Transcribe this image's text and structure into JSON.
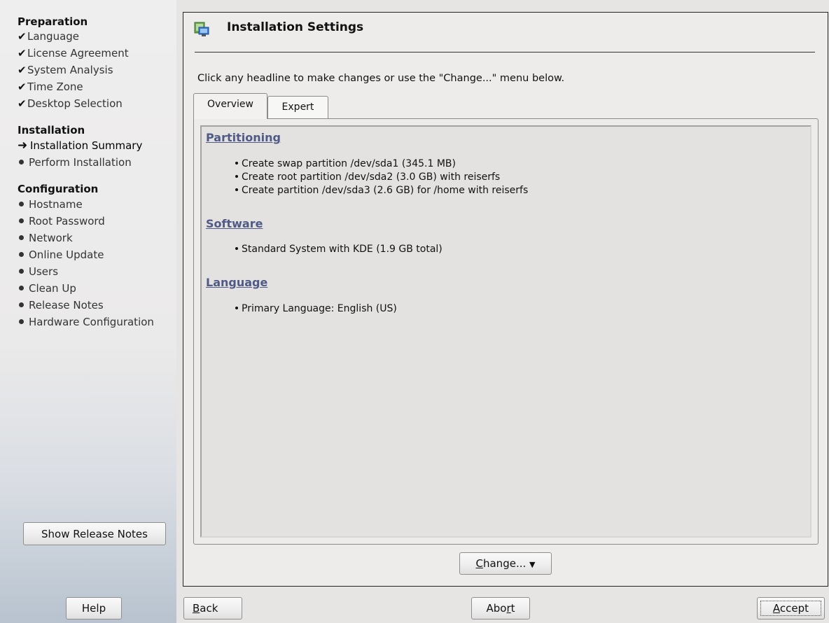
{
  "sidebar": {
    "sections": [
      {
        "title": "Preparation",
        "items": [
          {
            "label": "Language",
            "status": "done"
          },
          {
            "label": "License Agreement",
            "status": "done"
          },
          {
            "label": "System Analysis",
            "status": "done"
          },
          {
            "label": "Time Zone",
            "status": "done"
          },
          {
            "label": "Desktop Selection",
            "status": "done"
          }
        ]
      },
      {
        "title": "Installation",
        "items": [
          {
            "label": "Installation Summary",
            "status": "current"
          },
          {
            "label": "Perform Installation",
            "status": "pending"
          }
        ]
      },
      {
        "title": "Configuration",
        "items": [
          {
            "label": "Hostname",
            "status": "pending"
          },
          {
            "label": "Root Password",
            "status": "pending"
          },
          {
            "label": "Network",
            "status": "pending"
          },
          {
            "label": "Online Update",
            "status": "pending"
          },
          {
            "label": "Users",
            "status": "pending"
          },
          {
            "label": "Clean Up",
            "status": "pending"
          },
          {
            "label": "Release Notes",
            "status": "pending"
          },
          {
            "label": "Hardware Configuration",
            "status": "pending"
          }
        ]
      }
    ],
    "release_notes_button": "Show Release Notes"
  },
  "header": {
    "icon": "installation-settings-icon",
    "title": "Installation Settings"
  },
  "intro_text": "Click any headline to make changes or use the \"Change...\" menu below.",
  "tabs": [
    {
      "label": "Overview",
      "active": true
    },
    {
      "label": "Expert",
      "active": false
    }
  ],
  "summary": {
    "partitioning": {
      "title": "Partitioning",
      "items": [
        "Create swap partition /dev/sda1 (345.1 MB)",
        "Create root partition /dev/sda2 (3.0 GB) with reiserfs",
        "Create partition /dev/sda3 (2.6 GB) for /home with reiserfs"
      ]
    },
    "software": {
      "title": "Software",
      "items": [
        "Standard System with KDE (1.9 GB total)"
      ]
    },
    "language": {
      "title": "Language",
      "items": [
        "Primary Language: English (US)"
      ]
    }
  },
  "change_button": {
    "mnemonic": "C",
    "rest": "hange...",
    "arrow": "▼"
  },
  "bottom_buttons": {
    "help": "Help",
    "back": {
      "mnemonic": "B",
      "rest": "ack"
    },
    "abort": {
      "pre": "Abo",
      "mnemonic": "r",
      "rest": "t"
    },
    "accept": {
      "mnemonic": "A",
      "rest": "ccept"
    }
  },
  "colors": {
    "link": "#4f5a86",
    "background": "#e7e5e4",
    "panel": "#eeeceb"
  },
  "icons": {
    "done": "checkmark-icon",
    "current": "arrow-right-icon",
    "pending": "bullet-icon"
  }
}
